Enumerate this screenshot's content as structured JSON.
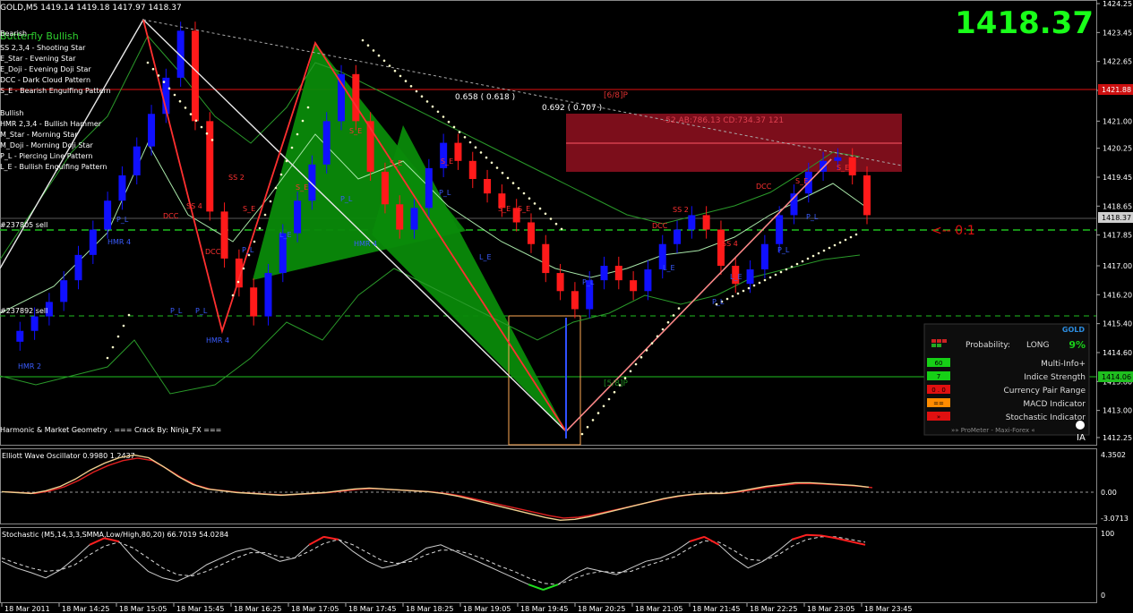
{
  "header": {
    "symbol_line": "GOLD,M5  1419.14 1419.18 1417.97 1418.37",
    "big_price": "1418.37"
  },
  "legend": {
    "butterfly_label": "Butterfly Bullish",
    "bearish_title": "Bearish",
    "bearish_items": [
      "SS 2,3,4 - Shooting Star",
      "E_Star   - Evening Star",
      "E_Doji   - Evening Doji Star",
      "DCC      - Dark Cloud Pattern",
      "S_E      - Bearish Engulfing Pattern"
    ],
    "bullish_title": "Bullish",
    "bullish_items": [
      "HMR 2,3,4 - Bullish Hammer",
      "M_Star    - Morning Star",
      "M_Doji    - Morning Doji Star",
      "P_L       - Piercing Line Pattern",
      "L_E       - Bullish Engulfing Pattern"
    ]
  },
  "order_labels": [
    "#237805 sell",
    "#237892 sell"
  ],
  "annotations": {
    "ratio1": "0.658 ( 0.618 )",
    "ratio2": "0.692 ( 0.707 )",
    "level_68": "[6/8]P",
    "level_58": "[5/8]P",
    "zone_text": "-52   AB:786.13 CD:734.37    121",
    "arrow_text": "<-- 0:1",
    "copyright": "Harmonic & Market Geometry .    === Crack By: Ninja_FX ===",
    "price_tag": "1418.37",
    "red_level_tag": "1421.88",
    "green_level_tag": "1414.06"
  },
  "pattern_labels": [
    "DCC",
    "DCC",
    "SS 4",
    "SS 2",
    "S_E",
    "S_E",
    "S_E",
    "S_E",
    "S_E",
    "S_E",
    "S_E",
    "SS 2",
    "SS 4",
    "DCC",
    "DCC",
    "S_E",
    "S_E",
    "P_L",
    "P_L",
    "P_L",
    "P_L",
    "P_L",
    "P_L",
    "P_L",
    "HMR 2",
    "HMR 4",
    "HMR 4",
    "HMR 4",
    "L_E",
    "L_E",
    "L_E",
    "L_E",
    "P_L",
    "P_L",
    "P_L"
  ],
  "panel": {
    "symbol": "GOLD",
    "probability_label": "Probability:",
    "probability_dir": "LONG",
    "probability_value": "9%",
    "rows": [
      {
        "badge": "60",
        "label": "Multi-Info+",
        "color": "#16d016"
      },
      {
        "badge": "7",
        "label": "Indice Strength",
        "color": "#16d016"
      },
      {
        "badge": "0 . 0",
        "label": "Currency Pair Range",
        "color": "#e01010"
      },
      {
        "badge": "==",
        "label": "MACD Indicator",
        "color": "#ff8c00"
      },
      {
        "badge": "»",
        "label": "Stochastic Indicator",
        "color": "#e01010"
      }
    ],
    "footer": "»» ProMeter - Maxi-Forex «",
    "logo": "IA"
  },
  "ewo": {
    "title": "Elliott Wave Oscillator 0.9980 1.2437",
    "ticks": [
      "4.3502",
      "0.00",
      "-3.0713"
    ]
  },
  "stoch": {
    "title": "Stochastic (M5,14,3,3,SMMA,Low/High,80,20) 66.7019 54.0284",
    "ticks": [
      "100",
      "0"
    ]
  },
  "colors": {
    "bull": "#1010ff",
    "bear": "#ff1a1a",
    "grid_green": "#1fbf1f",
    "price_green": "#19ff19",
    "zone": "#8a0f1e"
  },
  "chart_data": {
    "type": "candlestick",
    "ylim": [
      1412.1,
      1424.3
    ],
    "yticks": [
      1424.25,
      1423.45,
      1422.65,
      1421.85,
      1421.0,
      1420.25,
      1419.45,
      1418.65,
      1417.85,
      1417.0,
      1416.2,
      1415.4,
      1414.6,
      1413.8,
      1413.0,
      1412.25
    ],
    "xticks": [
      "18 Mar 2011",
      "18 Mar 14:25",
      "18 Mar 15:05",
      "18 Mar 15:45",
      "18 Mar 16:25",
      "18 Mar 17:05",
      "18 Mar 17:45",
      "18 Mar 18:25",
      "18 Mar 19:05",
      "18 Mar 19:45",
      "18 Mar 20:25",
      "18 Mar 21:05",
      "18 Mar 21:45",
      "18 Mar 22:25",
      "18 Mar 23:05",
      "18 Mar 23:45"
    ],
    "close_path": [
      1414.9,
      1415.2,
      1415.6,
      1416.0,
      1416.6,
      1417.3,
      1418.0,
      1418.8,
      1419.5,
      1420.3,
      1421.2,
      1422.2,
      1423.5,
      1421.0,
      1418.5,
      1417.2,
      1416.4,
      1415.6,
      1416.8,
      1417.9,
      1418.8,
      1419.8,
      1421.0,
      1422.3,
      1421.0,
      1419.6,
      1418.7,
      1418.0,
      1418.6,
      1419.7,
      1420.4,
      1419.9,
      1419.4,
      1419.0,
      1418.6,
      1418.2,
      1417.6,
      1416.8,
      1416.3,
      1415.8,
      1416.6,
      1417.0,
      1416.6,
      1416.3,
      1416.9,
      1417.6,
      1418.0,
      1418.4,
      1418.0,
      1417.0,
      1416.5,
      1416.9,
      1417.6,
      1418.4,
      1419.0,
      1419.6,
      1419.9,
      1420.0,
      1419.5,
      1418.4
    ],
    "last_price": 1418.37,
    "levels": {
      "red": 1421.88,
      "green_dash_1": 1417.85,
      "green_dash_2": 1415.7,
      "green_solid": 1414.06
    },
    "ewo": {
      "ylim": [
        -3.07,
        4.35
      ],
      "values": [
        0.2,
        0.1,
        0.0,
        0.3,
        0.8,
        1.6,
        2.6,
        3.4,
        4.0,
        4.3,
        4.0,
        3.0,
        1.9,
        1.0,
        0.5,
        0.3,
        0.1,
        0.0,
        -0.1,
        -0.2,
        -0.1,
        0.0,
        0.1,
        0.3,
        0.5,
        0.6,
        0.5,
        0.4,
        0.3,
        0.2,
        0.0,
        -0.3,
        -0.7,
        -1.1,
        -1.5,
        -1.9,
        -2.3,
        -2.7,
        -3.0,
        -2.9,
        -2.6,
        -2.2,
        -1.8,
        -1.4,
        -1.0,
        -0.6,
        -0.3,
        -0.1,
        0.0,
        0.0,
        0.2,
        0.5,
        0.8,
        1.0,
        1.2,
        1.2,
        1.1,
        1.0,
        0.9,
        0.7
      ]
    },
    "stoch": {
      "ylim": [
        0,
        100
      ],
      "main": [
        55,
        45,
        38,
        30,
        42,
        60,
        80,
        90,
        85,
        60,
        40,
        30,
        25,
        35,
        50,
        60,
        70,
        75,
        65,
        55,
        60,
        80,
        92,
        88,
        70,
        55,
        45,
        50,
        60,
        75,
        80,
        70,
        60,
        50,
        40,
        30,
        20,
        12,
        20,
        35,
        45,
        40,
        35,
        45,
        55,
        60,
        70,
        85,
        92,
        80,
        60,
        45,
        55,
        70,
        88,
        95,
        94,
        90,
        85,
        80
      ],
      "signal": [
        60,
        52,
        45,
        40,
        42,
        50,
        65,
        78,
        84,
        75,
        60,
        45,
        35,
        33,
        40,
        50,
        60,
        68,
        68,
        62,
        60,
        70,
        82,
        88,
        80,
        68,
        56,
        52,
        55,
        65,
        72,
        72,
        66,
        58,
        48,
        40,
        30,
        22,
        20,
        28,
        36,
        40,
        38,
        40,
        48,
        55,
        62,
        75,
        86,
        84,
        72,
        58,
        56,
        64,
        78,
        88,
        92,
        92,
        88,
        84
      ]
    }
  }
}
